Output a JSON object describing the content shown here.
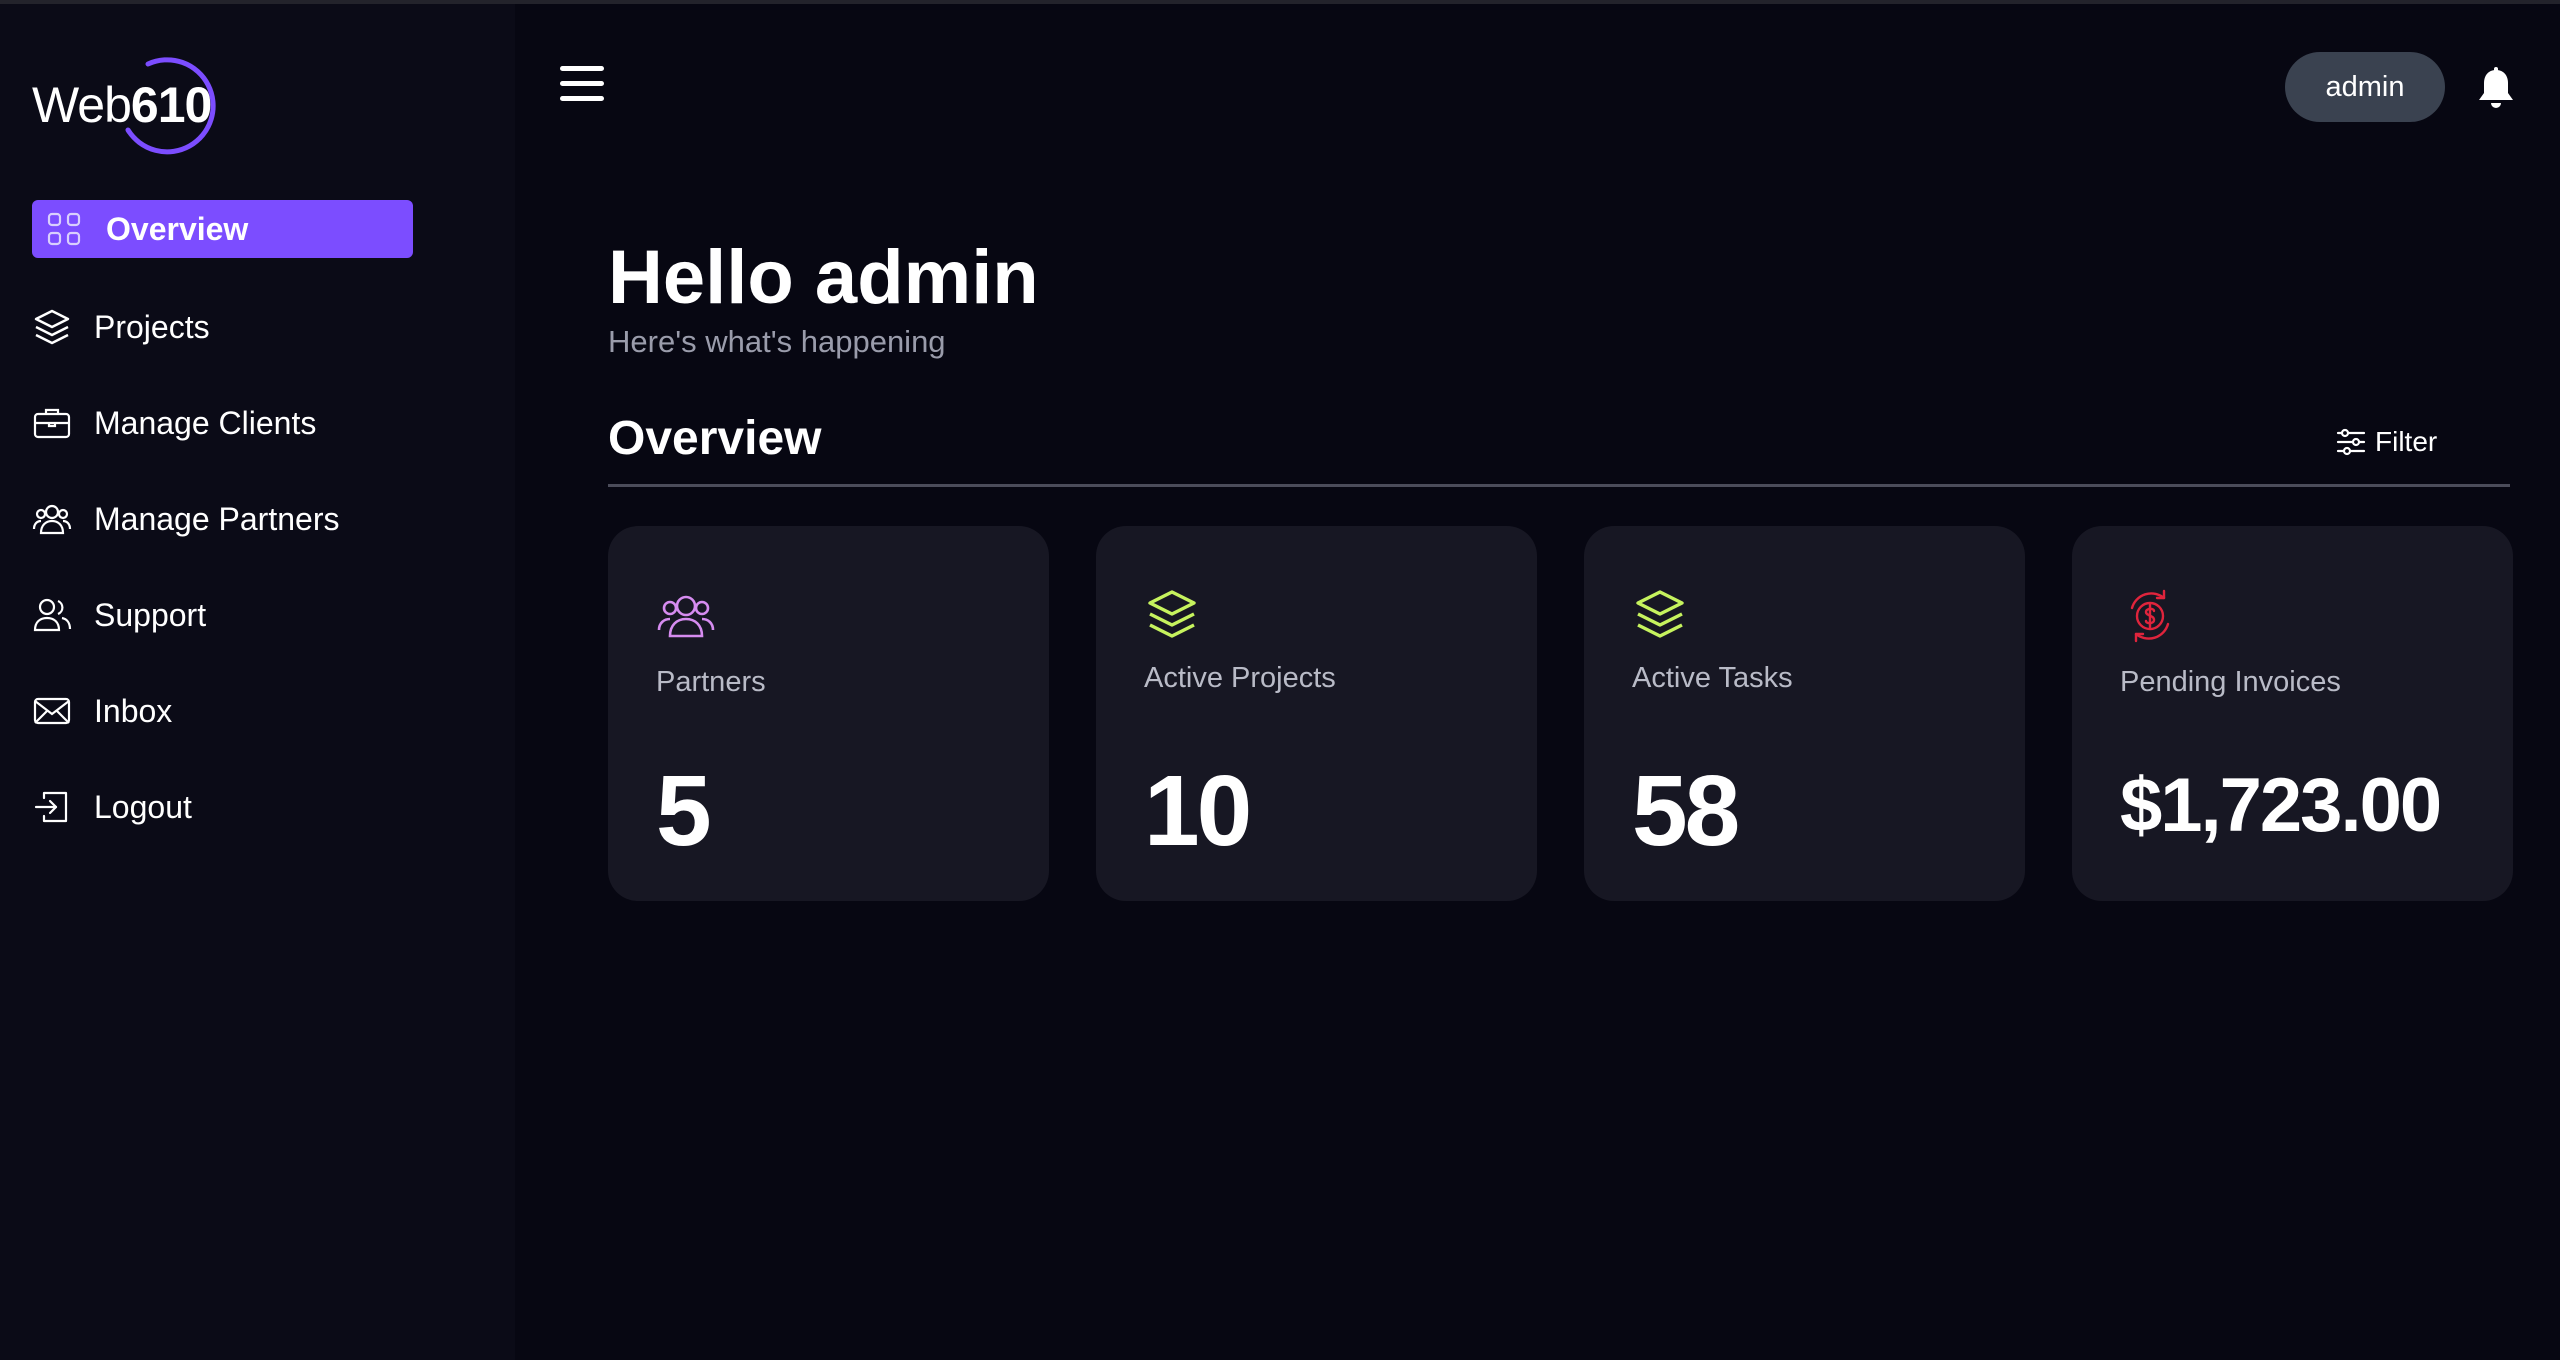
{
  "brand": {
    "name_prefix": "Web",
    "name_number": "610",
    "accent": "#7c4dff"
  },
  "sidebar": {
    "items": [
      {
        "label": "Overview",
        "icon": "grid-icon",
        "active": true
      },
      {
        "label": "Projects",
        "icon": "layers-icon",
        "active": false
      },
      {
        "label": "Manage Clients",
        "icon": "briefcase-icon",
        "active": false
      },
      {
        "label": "Manage Partners",
        "icon": "users-icon",
        "active": false
      },
      {
        "label": "Support",
        "icon": "support-users-icon",
        "active": false
      },
      {
        "label": "Inbox",
        "icon": "mail-icon",
        "active": false
      },
      {
        "label": "Logout",
        "icon": "logout-icon",
        "active": false
      }
    ]
  },
  "header": {
    "user": "admin",
    "menu_icon": "hamburger-icon",
    "notification_icon": "bell-icon"
  },
  "main": {
    "greeting": "Hello admin",
    "subgreeting": "Here's what's happening",
    "section_title": "Overview",
    "filter_label": "Filter"
  },
  "cards": [
    {
      "label": "Partners",
      "value": "5",
      "icon": "users-icon",
      "icon_color": "#d68cf0"
    },
    {
      "label": "Active Projects",
      "value": "10",
      "icon": "layers-icon",
      "icon_color": "#c6f35e"
    },
    {
      "label": "Active Tasks",
      "value": "58",
      "icon": "layers-icon",
      "icon_color": "#c6f35e"
    },
    {
      "label": "Pending Invoices",
      "value": "$1,723.00",
      "icon": "dollar-cycle-icon",
      "icon_color": "#e0243c"
    }
  ]
}
